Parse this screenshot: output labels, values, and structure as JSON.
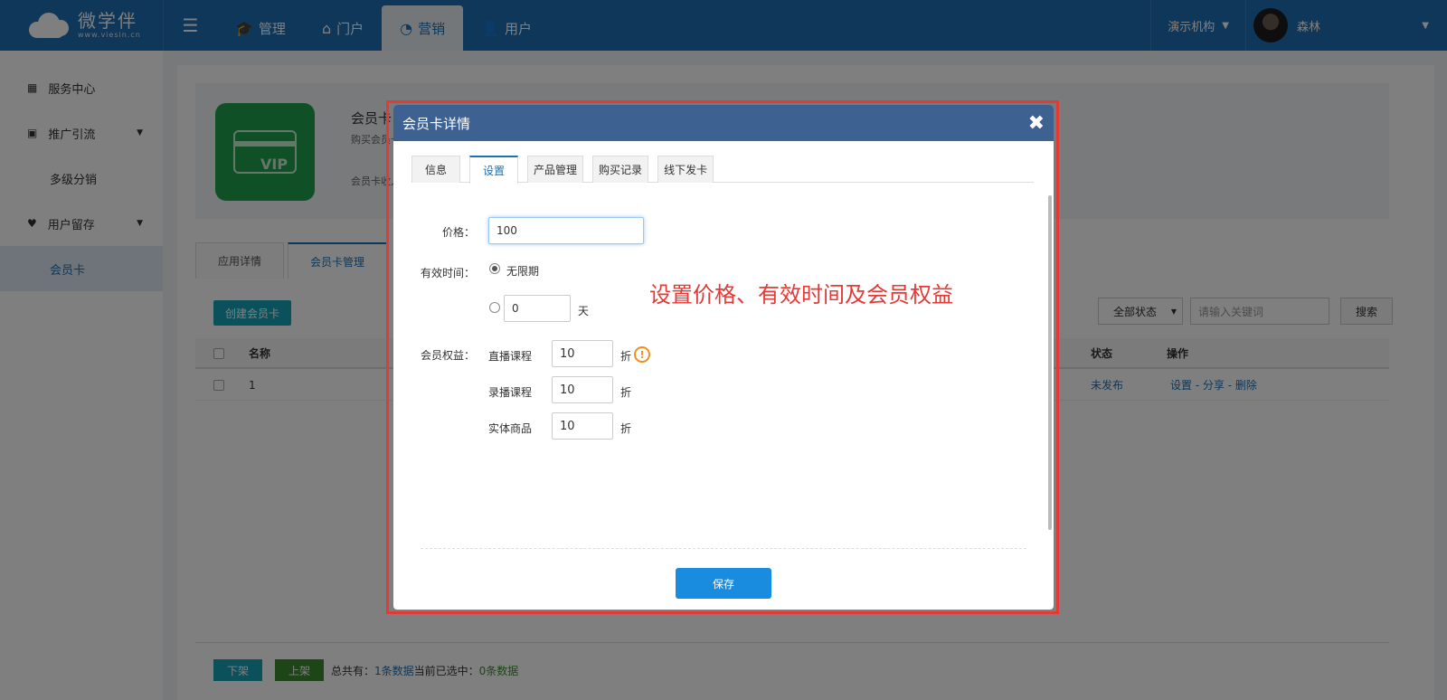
{
  "topbar": {
    "logo_cn": "微学伴",
    "logo_en": "www.viesin.cn",
    "nav": [
      {
        "label": "管理",
        "icon": "graduation-cap-icon"
      },
      {
        "label": "门户",
        "icon": "home-icon"
      },
      {
        "label": "营销",
        "icon": "marketing-icon"
      },
      {
        "label": "用户",
        "icon": "user-gear-icon"
      }
    ],
    "org": "演示机构",
    "username": "森林"
  },
  "sidebar": {
    "items": [
      {
        "label": "服务中心"
      },
      {
        "label": "推广引流"
      },
      {
        "label": "多级分销"
      },
      {
        "label": "用户留存"
      },
      {
        "label": "会员卡"
      }
    ]
  },
  "app": {
    "title": "会员卡",
    "desc": "购买会员卡",
    "income": "会员卡收入",
    "vip_text": "VIP"
  },
  "main_tabs": [
    "应用详情",
    "会员卡管理"
  ],
  "toolbar": {
    "create_label": "创建会员卡",
    "status_value": "全部状态",
    "keyword_placeholder": "请输入关键词",
    "search_label": "搜索"
  },
  "table": {
    "headers": {
      "name": "名称",
      "status": "状态",
      "ops": "操作"
    },
    "rows": [
      {
        "name": "1",
        "status": "未发布",
        "ops": "设置 -  分享 -  删除"
      }
    ]
  },
  "footer": {
    "down_label": "下架",
    "up_label": "上架",
    "total_prefix": "总共有：",
    "total_value": "1条数据",
    "selected_prefix": " 当前已选中：",
    "selected_value": "0条数据"
  },
  "modal": {
    "title": "会员卡详情",
    "close_glyph": "✖",
    "tabs": [
      "信息",
      "设置",
      "产品管理",
      "购买记录",
      "线下发卡"
    ],
    "price_label": "价格：",
    "price_value": "100",
    "validity_label": "有效时间：",
    "unlimited_label": "无限期",
    "days_value": "0",
    "days_unit": "天",
    "benefits_label": "会员权益：",
    "benefits": [
      {
        "label": "直播课程",
        "value": "10",
        "unit": "折"
      },
      {
        "label": "录播课程",
        "value": "10",
        "unit": "折"
      },
      {
        "label": "实体商品",
        "value": "10",
        "unit": "折"
      }
    ],
    "annotation": "设置价格、有效时间及会员权益",
    "save_label": "保存"
  },
  "colors": {
    "topbar": "#1e6fb3",
    "highlight": "#e53935",
    "save_button": "#1a8ce0"
  }
}
